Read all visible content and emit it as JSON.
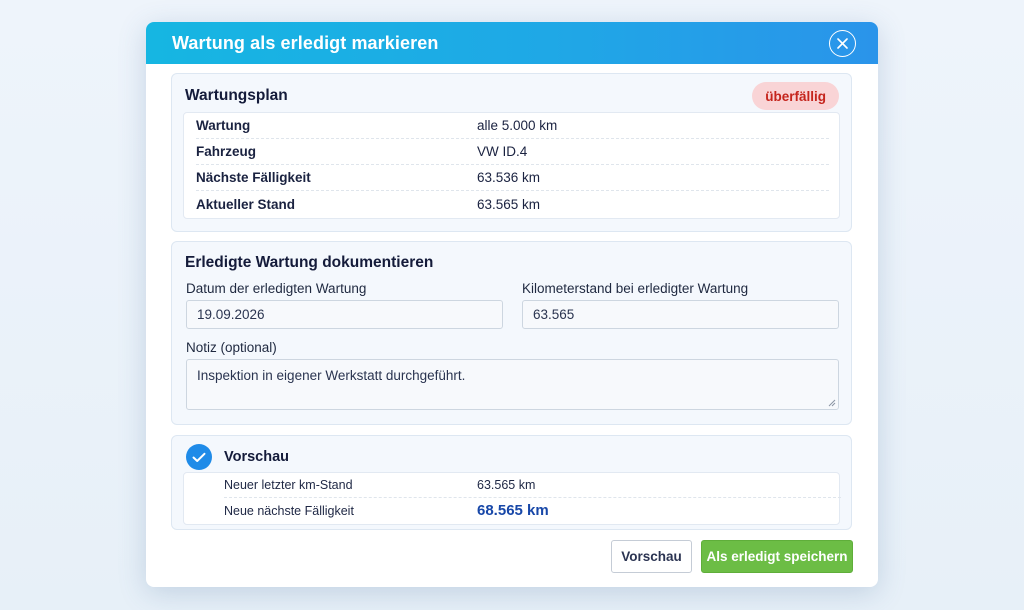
{
  "dialog": {
    "title": "Wartung als erledigt markieren"
  },
  "plan": {
    "title": "Wartungsplan",
    "badge": "überfällig",
    "rows": [
      {
        "label": "Wartung",
        "value": "alle 5.000 km"
      },
      {
        "label": "Fahrzeug",
        "value": "VW ID.4"
      },
      {
        "label": "Nächste Fälligkeit",
        "value": "63.536 km"
      },
      {
        "label": "Aktueller Stand",
        "value": "63.565 km"
      }
    ]
  },
  "form": {
    "title": "Erledigte Wartung dokumentieren",
    "date_label": "Datum der erledigten Wartung",
    "date_value": "19.09.2026",
    "km_label": "Kilometerstand bei erledigter Wartung",
    "km_value": "63.565",
    "note_label": "Notiz (optional)",
    "note_value": "Inspektion in eigener Werkstatt durchgeführt."
  },
  "preview": {
    "title": "Vorschau",
    "rows": [
      {
        "label": "Neuer letzter km-Stand",
        "value": "63.565 km"
      },
      {
        "label": "Neue nächste Fälligkeit",
        "value": "68.565 km"
      }
    ]
  },
  "buttons": {
    "preview": "Vorschau",
    "save": "Als erledigt speichern"
  },
  "colors": {
    "header": "#1fa8e6",
    "badge_bg": "#f9d4d6",
    "badge_text": "#c5241c",
    "primary": "#6cbd45",
    "highlight": "#1747a8"
  },
  "icons": [
    "close-icon",
    "checkmark-icon",
    "resize-grip-icon"
  ]
}
